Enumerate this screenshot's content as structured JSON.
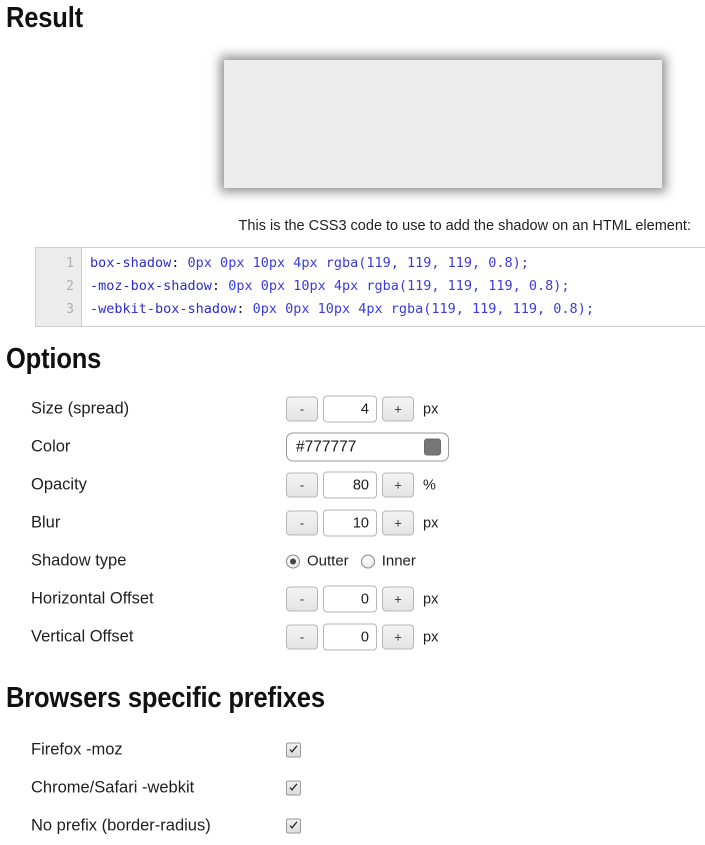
{
  "sections": {
    "result_heading": "Result",
    "options_heading": "Options",
    "prefixes_heading": "Browsers specific prefixes"
  },
  "preview": {
    "caption": "This is the CSS3 code to use to add the shadow on an HTML element:",
    "box_fill": "#ececec",
    "shadow_css": "0px 0px 10px 4px rgba(119, 119, 119, 0.8)"
  },
  "code": {
    "line_numbers": [
      "1",
      "2",
      "3"
    ],
    "lines": [
      {
        "property": "box-shadow",
        "colon": ":",
        "value": " 0px 0px 10px 4px rgba(119, 119, 119, 0.8);",
        "full": "box-shadow: 0px 0px 10px 4px rgba(119, 119, 119, 0.8);"
      },
      {
        "property": "-moz-box-shadow",
        "colon": ":",
        "value": " 0px 0px 10px 4px rgba(119, 119, 119, 0.8);",
        "full": "-moz-box-shadow: 0px 0px 10px 4px rgba(119, 119, 119, 0.8);"
      },
      {
        "property": "-webkit-box-shadow",
        "colon": ":",
        "value": " 0px 0px 10px 4px rgba(119, 119, 119, 0.8);",
        "full": "-webkit-box-shadow: 0px 0px 10px 4px rgba(119, 119, 119, 0.8);"
      }
    ]
  },
  "options": {
    "size": {
      "label": "Size (spread)",
      "minus": "-",
      "plus": "+",
      "value": "4",
      "unit": "px"
    },
    "color": {
      "label": "Color",
      "value": "#777777",
      "swatch": "#777777"
    },
    "opacity": {
      "label": "Opacity",
      "minus": "-",
      "plus": "+",
      "value": "80",
      "unit": "%"
    },
    "blur": {
      "label": "Blur",
      "minus": "-",
      "plus": "+",
      "value": "10",
      "unit": "px"
    },
    "shadow_type": {
      "label": "Shadow type",
      "outter_label": "Outter",
      "inner_label": "Inner",
      "selected": "Outter"
    },
    "horizontal_offset": {
      "label": "Horizontal Offset",
      "minus": "-",
      "plus": "+",
      "value": "0",
      "unit": "px"
    },
    "vertical_offset": {
      "label": "Vertical Offset",
      "minus": "-",
      "plus": "+",
      "value": "0",
      "unit": "px"
    }
  },
  "prefixes": [
    {
      "label": "Firefox -moz",
      "checked": true
    },
    {
      "label": "Chrome/Safari -webkit",
      "checked": true
    },
    {
      "label": "No prefix (border-radius)",
      "checked": true
    }
  ]
}
